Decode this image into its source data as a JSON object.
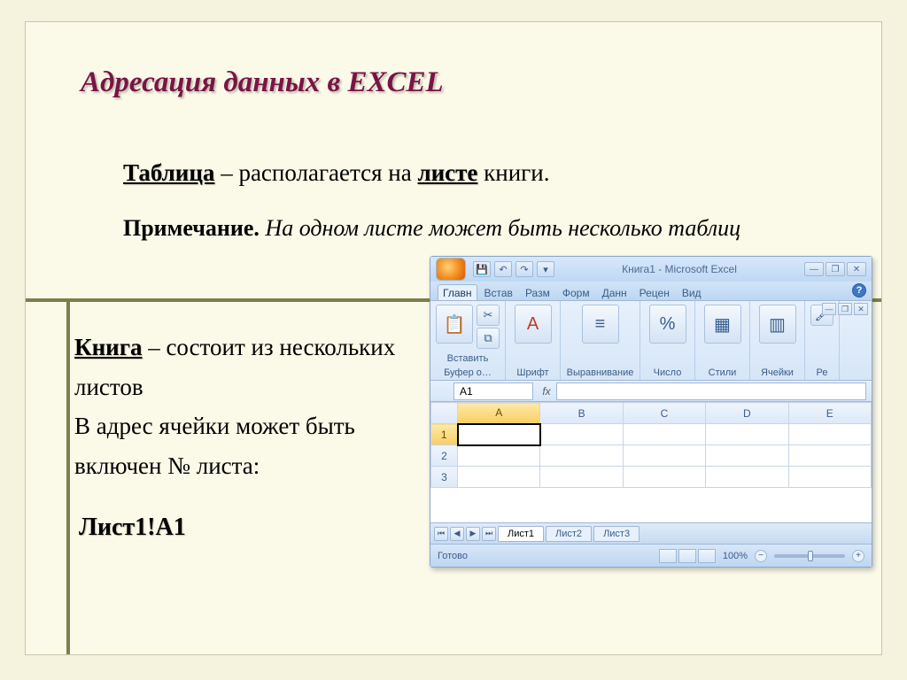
{
  "slide": {
    "title": "Адресация данных в EXCEL",
    "paragraph1": {
      "word_table": "Таблица",
      "mid": " – располагается на ",
      "word_sheet": "листе",
      "tail": " книги."
    },
    "note": {
      "label": "Примечание.",
      "text": " На одном листе может быть несколько таблиц"
    },
    "book": {
      "word_book": "Книга",
      "rest": " – состоит из нескольких листов",
      "line2": "В адрес ячейки может быть включен № листа:"
    },
    "sheet_ref": "Лист1!A1"
  },
  "excel": {
    "titlebar": {
      "caption": "Книга1 - Microsoft Excel",
      "qat_sep": "▾"
    },
    "ribbon_tabs": [
      "Главн",
      "Встав",
      "Разм",
      "Форм",
      "Данн",
      "Рецен",
      "Вид"
    ],
    "ribbon_groups": {
      "paste": "Вставить",
      "clipboard": "Буфер о…",
      "font": "Шрифт",
      "align": "Выравнивание",
      "number": "Число",
      "styles": "Стили",
      "cells": "Ячейки",
      "edit": "Ре"
    },
    "namebox": "A1",
    "fx": "fx",
    "columns": [
      "A",
      "B",
      "C",
      "D",
      "E"
    ],
    "rows": [
      "1",
      "2",
      "3"
    ],
    "sheets": [
      "Лист1",
      "Лист2",
      "Лист3"
    ],
    "status": {
      "ready": "Готово",
      "zoom": "100%"
    },
    "icons": {
      "save": "💾",
      "undo": "↶",
      "redo": "↷",
      "min": "—",
      "max": "❐",
      "close": "✕",
      "help": "?",
      "paste": "📋",
      "scissors": "✂",
      "copy": "⧉",
      "brush": "🖌",
      "fontA": "A",
      "align": "≡",
      "percent": "%",
      "styles": "▦",
      "cells": "▥",
      "first": "⏮",
      "prev": "◀",
      "next": "▶",
      "last": "⏭",
      "plus": "+",
      "minus": "−"
    }
  }
}
